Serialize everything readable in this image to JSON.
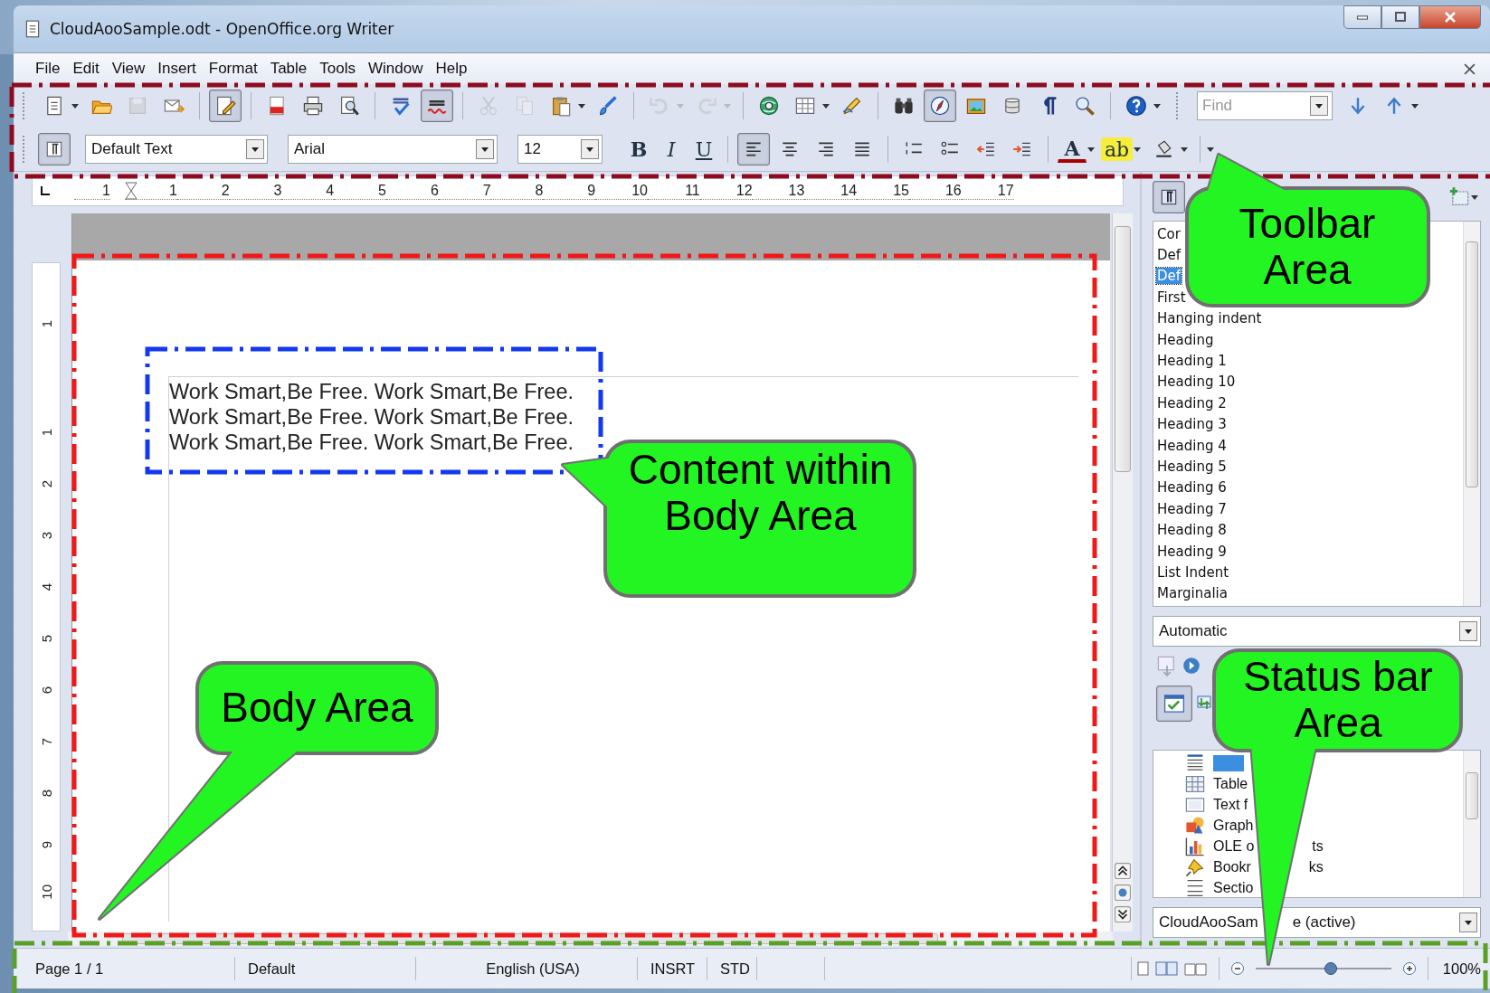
{
  "window": {
    "title": "CloudAooSample.odt - OpenOffice.org Writer"
  },
  "menu": [
    "File",
    "Edit",
    "View",
    "Insert",
    "Format",
    "Table",
    "Tools",
    "Window",
    "Help"
  ],
  "standard_toolbar": [
    {
      "kind": "new",
      "on": false,
      "disabled": false
    },
    {
      "kind": "open",
      "on": false,
      "disabled": false
    },
    {
      "kind": "save",
      "on": false,
      "disabled": true
    },
    {
      "kind": "email",
      "on": false,
      "disabled": false
    },
    {
      "kind": "edit",
      "on": true,
      "disabled": false
    },
    {
      "kind": "pdf",
      "on": false,
      "disabled": false
    },
    {
      "kind": "print",
      "on": false,
      "disabled": false
    },
    {
      "kind": "preview",
      "on": false,
      "disabled": false
    },
    {
      "kind": "spell",
      "on": false,
      "disabled": false
    },
    {
      "kind": "autospell",
      "on": true,
      "disabled": false
    },
    {
      "kind": "cut",
      "on": false,
      "disabled": true
    },
    {
      "kind": "copy",
      "on": false,
      "disabled": true
    },
    {
      "kind": "paste",
      "on": false,
      "disabled": false
    },
    {
      "kind": "brush",
      "on": false,
      "disabled": false
    },
    {
      "kind": "undo",
      "on": false,
      "disabled": true
    },
    {
      "kind": "redo",
      "on": false,
      "disabled": true
    },
    {
      "kind": "hyperlink",
      "on": false,
      "disabled": false
    },
    {
      "kind": "table",
      "on": false,
      "disabled": false
    },
    {
      "kind": "draw",
      "on": false,
      "disabled": false
    },
    {
      "kind": "find",
      "on": false,
      "disabled": false
    },
    {
      "kind": "navigator",
      "on": true,
      "disabled": false
    },
    {
      "kind": "gallery",
      "on": false,
      "disabled": false
    },
    {
      "kind": "datasource",
      "on": false,
      "disabled": false
    },
    {
      "kind": "pilcrow",
      "on": false,
      "disabled": false
    },
    {
      "kind": "zoom",
      "on": false,
      "disabled": false
    },
    {
      "kind": "help",
      "on": false,
      "disabled": false
    }
  ],
  "find_bar": {
    "placeholder": "Find"
  },
  "formatting_toolbar": {
    "paragraph_style": "Default Text",
    "font": "Arial",
    "size": "12",
    "buttons": [
      {
        "kind": "bold",
        "label": "B",
        "on": false
      },
      {
        "kind": "italic",
        "label": "I",
        "on": false
      },
      {
        "kind": "underline",
        "label": "U",
        "on": false
      },
      {
        "kind": "align-left",
        "on": true
      },
      {
        "kind": "align-center",
        "on": false
      },
      {
        "kind": "align-right",
        "on": false
      },
      {
        "kind": "justify",
        "on": false
      },
      {
        "kind": "numbering",
        "on": false
      },
      {
        "kind": "bullets",
        "on": false
      },
      {
        "kind": "outdent",
        "on": false
      },
      {
        "kind": "indent",
        "on": false
      },
      {
        "kind": "font-color",
        "label": "A",
        "on": false
      },
      {
        "kind": "highlight",
        "label": "ab",
        "on": false
      },
      {
        "kind": "background",
        "on": false
      }
    ]
  },
  "ruler": {
    "horizontal": [
      "1",
      "1",
      "2",
      "3",
      "4",
      "5",
      "6",
      "7",
      "8",
      "9",
      "10",
      "11",
      "12",
      "13",
      "14",
      "15",
      "16",
      "17"
    ],
    "vertical": [
      "1",
      "1",
      "2",
      "3",
      "4",
      "5",
      "6",
      "7",
      "8",
      "9",
      "10"
    ]
  },
  "document": {
    "lines": [
      "Work Smart,Be Free. Work Smart,Be Free.",
      "Work Smart,Be Free. Work Smart,Be Free.",
      "Work Smart,Be Free. Work Smart,Be Free."
    ]
  },
  "styles_panel": {
    "items": [
      {
        "label": "Cor",
        "selected": false
      },
      {
        "label": "Def",
        "selected": false
      },
      {
        "label": "Def",
        "selected": true
      },
      {
        "label": "First",
        "selected": false
      },
      {
        "label": "Hanging indent",
        "selected": false
      },
      {
        "label": "Heading",
        "selected": false
      },
      {
        "label": "Heading 1",
        "selected": false
      },
      {
        "label": "Heading 10",
        "selected": false
      },
      {
        "label": "Heading 2",
        "selected": false
      },
      {
        "label": "Heading 3",
        "selected": false
      },
      {
        "label": "Heading 4",
        "selected": false
      },
      {
        "label": "Heading 5",
        "selected": false
      },
      {
        "label": "Heading 6",
        "selected": false
      },
      {
        "label": "Heading 7",
        "selected": false
      },
      {
        "label": "Heading 8",
        "selected": false
      },
      {
        "label": "Heading 9",
        "selected": false
      },
      {
        "label": "List Indent",
        "selected": false
      },
      {
        "label": "Marginalia",
        "selected": false
      }
    ],
    "filter": "Automatic"
  },
  "navigator": {
    "items": [
      {
        "kind": "headings",
        "selected": true
      },
      {
        "kind": "tables",
        "label": "Table",
        "selected": false
      },
      {
        "kind": "frames",
        "label": "Text f",
        "selected": false
      },
      {
        "kind": "graphics",
        "label": "Graph",
        "selected": false
      },
      {
        "kind": "ole",
        "label": "OLE o",
        "tail": "ts",
        "selected": false
      },
      {
        "kind": "bookmarks",
        "label": "Bookr",
        "tail": "ks",
        "selected": false
      },
      {
        "kind": "sections",
        "label": "Sectio",
        "selected": false
      }
    ],
    "document_parts": [
      "CloudAooSam",
      "e (active)"
    ]
  },
  "status_bar": {
    "page": "Page 1 / 1",
    "style": "Default",
    "language": "English (USA)",
    "insert_mode": "INSRT",
    "selection_mode": "STD",
    "zoom": {
      "level": 0.55,
      "reading": "100%"
    }
  },
  "annotations": [
    {
      "kind": "toolbar",
      "text": "Toolbar Area"
    },
    {
      "kind": "content",
      "text": "Content within Body Area"
    },
    {
      "kind": "body",
      "text": "Body Area"
    },
    {
      "kind": "status",
      "text": "Status bar Area"
    }
  ]
}
